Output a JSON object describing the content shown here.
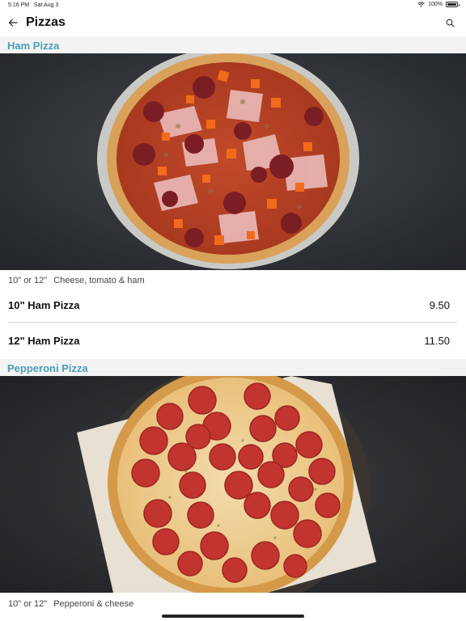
{
  "status_bar": {
    "time": "5:16 PM",
    "date": "Sat Aug 3",
    "battery": "100%"
  },
  "nav": {
    "title": "Pizzas",
    "back_icon": "arrow-left-icon",
    "search_icon": "search-icon"
  },
  "sections": [
    {
      "title": "Ham Pizza",
      "description_sizes": "10\" or 12\"",
      "description_text": "Cheese, tomato & ham",
      "items": [
        {
          "name": "10\" Ham Pizza",
          "price": "9.50"
        },
        {
          "name": "12\" Ham Pizza",
          "price": "11.50"
        }
      ]
    },
    {
      "title": "Pepperoni Pizza",
      "description_sizes": "10\" or 12\"",
      "description_text": "Pepperoni & cheese",
      "items": []
    }
  ],
  "colors": {
    "accent": "#4a9fb5",
    "section_bg": "#f3f3f3",
    "hero_bg": "#2c2f33"
  }
}
